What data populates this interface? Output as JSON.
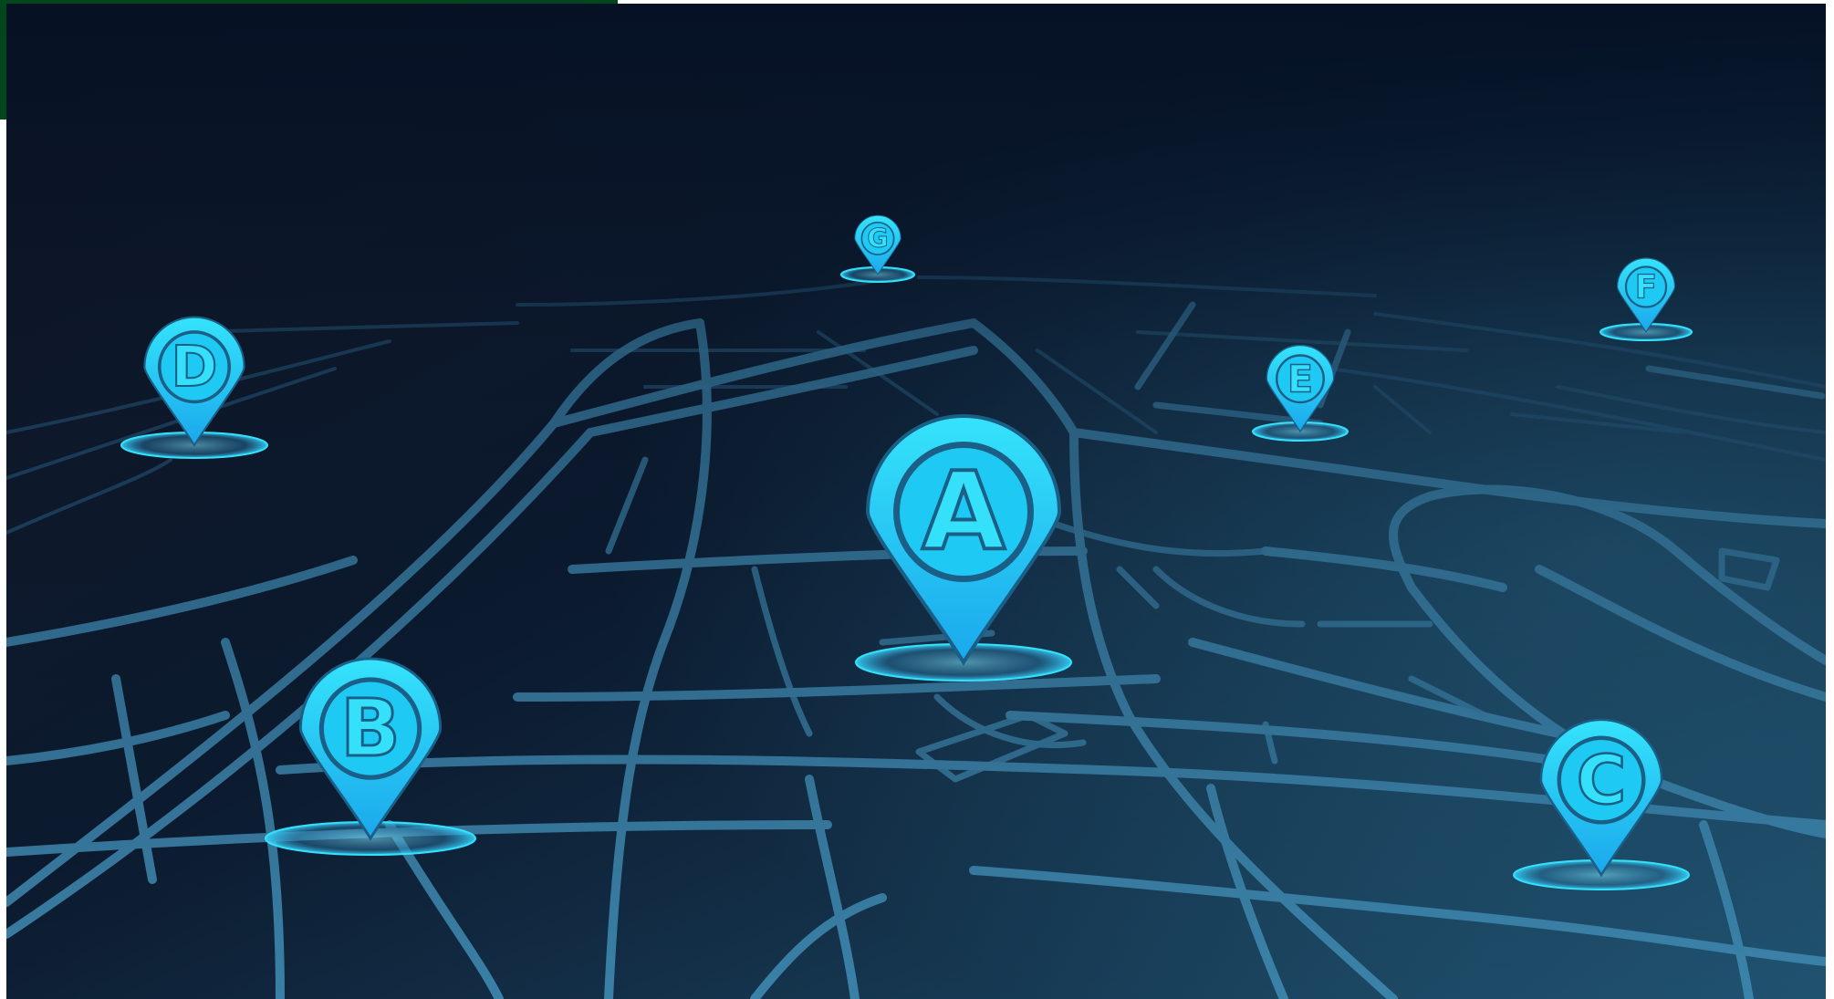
{
  "map": {
    "style": "dark navigation map, perspective street grid",
    "colors": {
      "sky_top": "#061427",
      "sky_left": "#151726",
      "ground": "#172a3a",
      "road": "#3f89b1",
      "road_faint": "#2b5f82",
      "pin": "#1ec9f4",
      "pin_light": "#35e0fb",
      "pin_ring": "#1b5f86",
      "corner_box": "#02461d"
    },
    "pins": [
      {
        "id": "a",
        "label": "A",
        "icon": "location-pin-icon"
      },
      {
        "id": "b",
        "label": "B",
        "icon": "location-pin-icon"
      },
      {
        "id": "c",
        "label": "C",
        "icon": "location-pin-icon"
      },
      {
        "id": "d",
        "label": "D",
        "icon": "location-pin-icon"
      },
      {
        "id": "e",
        "label": "E",
        "icon": "location-pin-icon"
      },
      {
        "id": "f",
        "label": "F",
        "icon": "location-pin-icon"
      },
      {
        "id": "g",
        "label": "G",
        "icon": "location-pin-icon"
      }
    ]
  }
}
